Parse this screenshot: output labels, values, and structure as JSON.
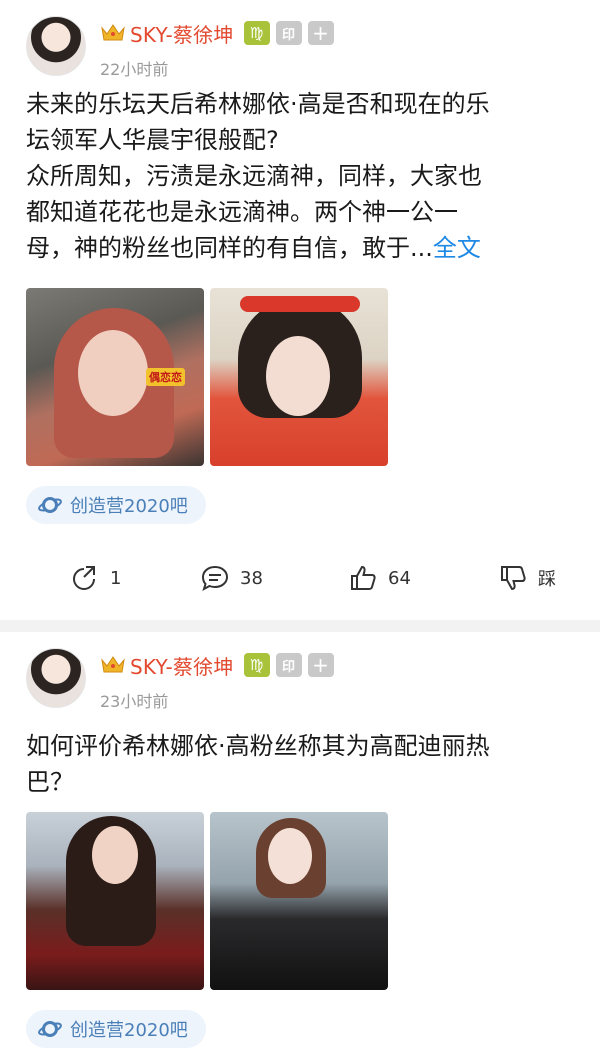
{
  "posts": [
    {
      "user": {
        "name": "SKY-蔡徐坤",
        "zodiac": "♍",
        "yin": "印",
        "plus": "+"
      },
      "time": "22小时前",
      "text_lines": [
        "未来的乐坛天后希林娜依·高是否和现在的乐",
        "坛领军人华晨宇很般配?",
        "众所周知，污渍是永远滴神，同样，大家也",
        "都知道花花也是永远滴神。两个神一公一",
        "母，神的粉丝也同样的有自信，敢于..."
      ],
      "more_label": "全文",
      "tag": "创造营2020吧",
      "photo_sticker": "偶恋恋",
      "actions": {
        "share": "1",
        "comment": "38",
        "like": "64",
        "dislike": "踩"
      }
    },
    {
      "user": {
        "name": "SKY-蔡徐坤",
        "zodiac": "♍",
        "yin": "印",
        "plus": "+"
      },
      "time": "23小时前",
      "text_lines": [
        "如何评价希林娜依·高粉丝称其为高配迪丽热",
        "巴？"
      ],
      "tag": "创造营2020吧"
    }
  ],
  "colors": {
    "username": "#e2492f",
    "link": "#1e88e5",
    "tag_bg": "#eef4fb",
    "tag_text": "#4a7fb8"
  }
}
